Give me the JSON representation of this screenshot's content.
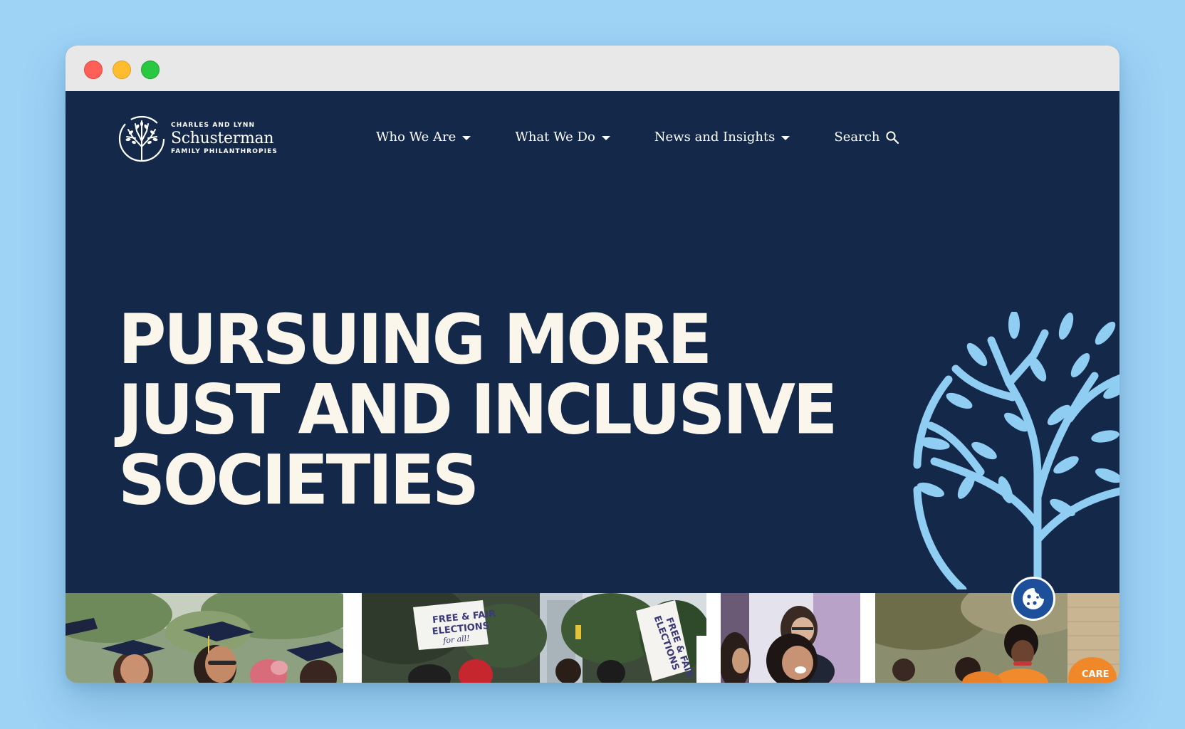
{
  "logo": {
    "line1": "CHARLES AND LYNN",
    "line2": "Schusterman",
    "line3": "FAMILY PHILANTHROPIES",
    "icon": "tree-icon"
  },
  "nav": {
    "items": [
      {
        "label": "Who We Are"
      },
      {
        "label": "What We Do"
      },
      {
        "label": "News and Insights"
      }
    ],
    "search_label": "Search"
  },
  "hero": {
    "lines": [
      "PURSUING MORE",
      "JUST AND INCLUSIVE",
      "SOCIETIES"
    ]
  },
  "photos": {
    "sign1": "FREE & FAIR ELECTIONS for all!",
    "sign2": "FREE & FAIR ELECTIONS for all!",
    "shirt": "CARE"
  },
  "colors": {
    "background": "#9ed3f6",
    "navy": "#14294a",
    "hero_text": "#fbf6ec",
    "tree_accent": "#8fcdf3",
    "cookie_button": "#1d4f9a"
  }
}
